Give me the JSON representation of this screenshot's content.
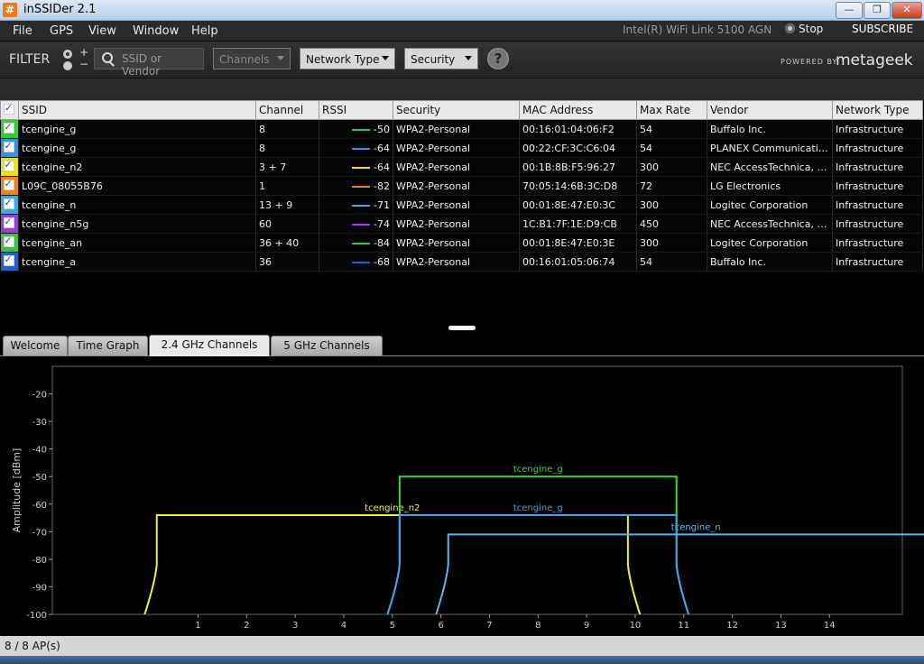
{
  "window": {
    "title": "inSSIDer 2.1",
    "min": "—",
    "max": "❐",
    "close": "✕"
  },
  "menu": {
    "items": [
      "File",
      "GPS",
      "View",
      "Window",
      "Help"
    ],
    "adapter": "Intel(R) WiFi Link 5100 AGN",
    "stop": "Stop",
    "subscribe": "SUBSCRIBE"
  },
  "filter": {
    "label": "FILTER",
    "plus": "+",
    "minus": "−",
    "search_placeholder": "SSID or Vendor",
    "channels": "Channels",
    "network_type": "Network Type",
    "security": "Security",
    "help": "?",
    "powered_by": "POWERED BY",
    "logo": "metageek"
  },
  "table": {
    "columns": [
      "SSID",
      "Channel",
      "RSSI",
      "Security",
      "MAC Address",
      "Max Rate",
      "Vendor",
      "Network Type"
    ],
    "rows": [
      {
        "color": "#33cc33",
        "ssid": "tcengine_g",
        "channel": "8",
        "rssi": "-50",
        "security": "WPA2-Personal",
        "mac": "00:16:01:04:06:F2",
        "rate": "54",
        "vendor": "Buffalo Inc.",
        "type": "Infrastructure"
      },
      {
        "color": "#3a8fe0",
        "ssid": "tcengine_g",
        "channel": "8",
        "rssi": "-64",
        "security": "WPA2-Personal",
        "mac": "00:22:CF:3C:C6:04",
        "rate": "54",
        "vendor": "PLANEX Communication...",
        "type": "Infrastructure"
      },
      {
        "color": "#e6e600",
        "ssid": "tcengine_n2",
        "channel": "3 + 7",
        "rssi": "-64",
        "security": "WPA2-Personal",
        "mac": "00:1B:8B:F5:96:27",
        "rate": "300",
        "vendor": "NEC AccessTechnica, Lt...",
        "type": "Infrastructure"
      },
      {
        "color": "#f08020",
        "ssid": "L09C_08055B76",
        "channel": "1",
        "rssi": "-82",
        "security": "WPA2-Personal",
        "mac": "70:05:14:6B:3C:D8",
        "rate": "72",
        "vendor": "LG Electronics",
        "type": "Infrastructure"
      },
      {
        "color": "#40a8e0",
        "ssid": "tcengine_n",
        "channel": "13 + 9",
        "rssi": "-71",
        "security": "WPA2-Personal",
        "mac": "00:01:8E:47:E0:3C",
        "rate": "300",
        "vendor": "Logitec Corporation",
        "type": "Infrastructure"
      },
      {
        "color": "#9a40d0",
        "ssid": "tcengine_n5g",
        "channel": "60",
        "rssi": "-74",
        "security": "WPA2-Personal",
        "mac": "1C:B1:7F:1E:D9:CB",
        "rate": "450",
        "vendor": "NEC AccessTechnica, Lt...",
        "type": "Infrastructure"
      },
      {
        "color": "#40c040",
        "ssid": "tcengine_an",
        "channel": "36 + 40",
        "rssi": "-84",
        "security": "WPA2-Personal",
        "mac": "00:01:8E:47:E0:3E",
        "rate": "300",
        "vendor": "Logitec Corporation",
        "type": "Infrastructure"
      },
      {
        "color": "#2060d0",
        "ssid": "tcengine_a",
        "channel": "36",
        "rssi": "-68",
        "security": "WPA2-Personal",
        "mac": "00:16:01:05:06:74",
        "rate": "54",
        "vendor": "Buffalo Inc.",
        "type": "Infrastructure"
      }
    ]
  },
  "tabs": [
    "Welcome",
    "Time Graph",
    "2.4 GHz Channels",
    "5 GHz Channels"
  ],
  "chart_data": {
    "type": "area",
    "ylabel": "Amplitude [dBm]",
    "xlabel": "",
    "title": "",
    "ylim": [
      -100,
      -10
    ],
    "xlim": [
      -2,
      15.5
    ],
    "y_ticks": [
      -20,
      -30,
      -40,
      -50,
      -60,
      -70,
      -80,
      -90,
      -100
    ],
    "x_ticks": [
      1,
      2,
      3,
      4,
      5,
      6,
      7,
      8,
      9,
      10,
      11,
      12,
      13,
      14
    ],
    "grid": false,
    "series": [
      {
        "name": "tcengine_n2",
        "color": "#f0f03c",
        "start": 1,
        "end": 9,
        "level": -64
      },
      {
        "name": "tcengine_g",
        "color": "#3cd63c",
        "start": 6,
        "end": 10,
        "level": -50
      },
      {
        "name": "tcengine_g",
        "color": "#4aa0e8",
        "start": 6,
        "end": 10,
        "level": -64
      },
      {
        "name": "tcengine_n",
        "color": "#5ab8f0",
        "start": 7,
        "end": 15.5,
        "level": -71
      }
    ]
  },
  "status": {
    "ap_count": "8 / 8 AP(s)"
  }
}
